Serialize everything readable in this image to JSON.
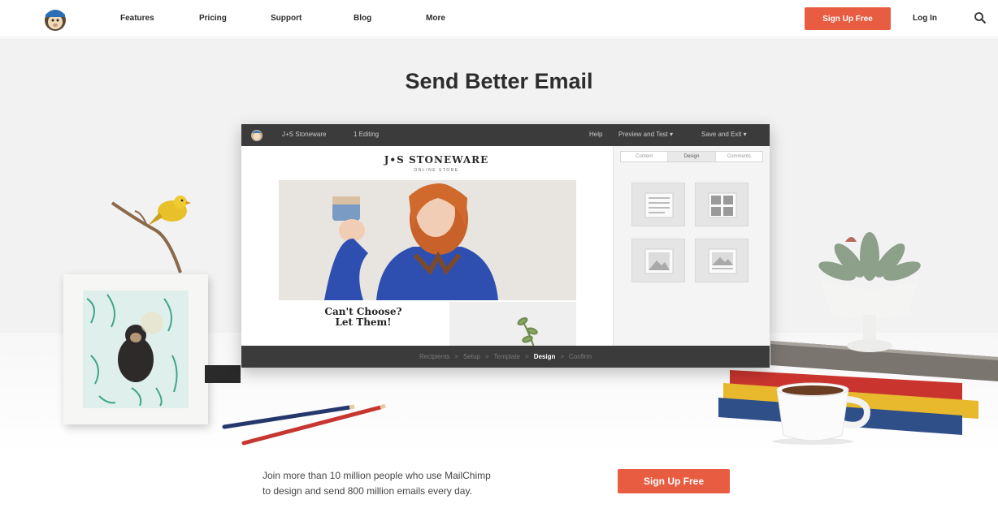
{
  "nav": {
    "links": [
      "Features",
      "Pricing",
      "Support",
      "Blog",
      "More"
    ],
    "signup_label": "Sign Up Free",
    "login_label": "Log In"
  },
  "hero": {
    "headline": "Send Better Email"
  },
  "editor": {
    "campaign_name": "J+S Stoneware",
    "editing_status": "1 Editing",
    "help_label": "Help",
    "preview_label": "Preview and Test ▾",
    "save_label": "Save and Exit ▾",
    "tabs": [
      "Content",
      "Design",
      "Comments"
    ],
    "active_tab": "Design",
    "brand_name": "J•S STONEWARE",
    "brand_subtitle": "ONLINE STORE",
    "cta_line1": "Can't Choose?",
    "cta_line2": "Let Them!",
    "steps": [
      "Recipients",
      "Setup",
      "Template",
      "Design",
      "Confirm"
    ],
    "active_step": "Design"
  },
  "footer": {
    "tagline_line1": "Join more than 10 million people who use MailChimp",
    "tagline_line2": "to design and send 800 million emails every day.",
    "signup_label": "Sign Up Free"
  },
  "colors": {
    "accent": "#e85c41",
    "editor_bar": "#3b3b3b",
    "hero_bg": "#f2f2f2"
  },
  "icons": [
    "mailchimp-logo-icon",
    "search-icon",
    "text-block-icon",
    "social-block-icon",
    "image-block-icon",
    "image-card-block-icon"
  ]
}
